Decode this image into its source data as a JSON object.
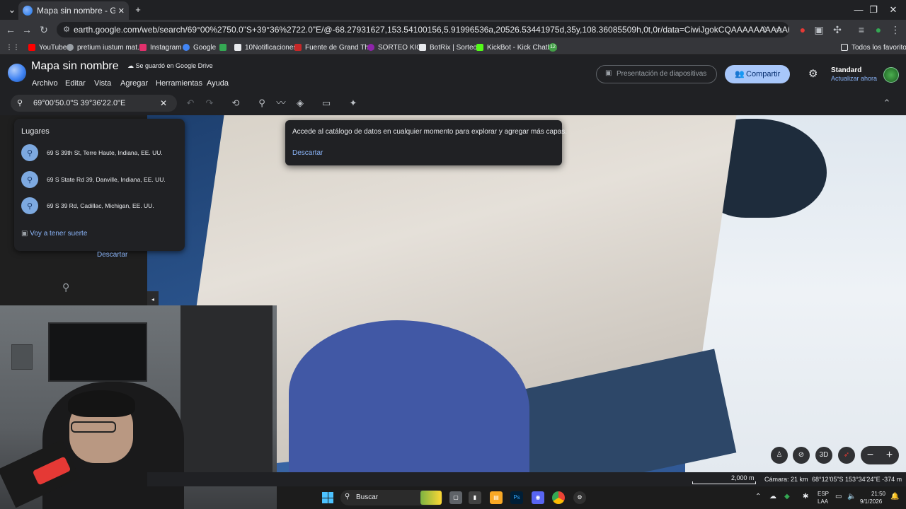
{
  "browser": {
    "tab_title": "Mapa sin nombre - Google Earth",
    "new_tab": "+",
    "url": "earth.google.com/web/search/69°00%2750.0\"S+39°36%2722.0\"E/@-68.27931627,153.54100156,5.91996536a,20526.53441975d,35y,108.36085509h,0t,0r/data=CiwiJgokCQAAAAAAAAAAEQAAAAAAAAAAGQAAAAAAAAAAIQAAAAAA..."
  },
  "bookmarks": [
    {
      "label": "YouTube",
      "color": "#ff0000"
    },
    {
      "label": "pretium iustum mat...",
      "color": "#9aa0a6"
    },
    {
      "label": "Instagram",
      "color": "#e1306c"
    },
    {
      "label": "Google",
      "color": "#4285f4"
    },
    {
      "label": "",
      "color": "#34a853"
    },
    {
      "label": "10Notificaciones",
      "color": "#e8eaed"
    },
    {
      "label": "Fuente de Grand Th...",
      "color": "#c62828"
    },
    {
      "label": "SORTEO KICK",
      "color": "#8e24aa"
    },
    {
      "label": "BotRix | Sorteos",
      "color": "#e8eaed"
    },
    {
      "label": "KickBot - Kick Chatb...",
      "color": "#53fc18"
    },
    {
      "label": "12",
      "color": "#43a047"
    }
  ],
  "bookmarks_all": "Todos los favoritos",
  "earth": {
    "doc_title": "Mapa sin nombre",
    "saved_status": "Se guardó en Google Drive",
    "menu": [
      "Archivo",
      "Editar",
      "Vista",
      "Agregar",
      "Herramientas",
      "Ayuda"
    ],
    "slideshow": "Presentación de diapositivas",
    "share": "Compartir",
    "plan": "Standard",
    "upgrade": "Actualizar ahora",
    "search_value": "69°00'50.0\"S 39°36'22.0\"E"
  },
  "places": {
    "heading": "Lugares",
    "items": [
      "69 S 39th St, Terre Haute, Indiana, EE. UU.",
      "69 S State Rd 39, Danville, Indiana, EE. UU.",
      "69 S 39 Rd, Cadillac, Michigan, EE. UU."
    ],
    "lucky": "Voy a tener suerte",
    "dismiss": "Descartar"
  },
  "tooltip": {
    "text": "Accede al catálogo de datos en cualquier momento para explorar y agregar más capas.",
    "dismiss": "Descartar"
  },
  "map_controls": {
    "three_d": "3D",
    "zoom_out": "−",
    "zoom_in": "+"
  },
  "status": {
    "scale": "2,000 m",
    "camera": "Cámara: 21 km",
    "coords": "68°12'05\"S 153°34'24\"E -374 m"
  },
  "taskbar": {
    "search": "Buscar",
    "lang1": "ESP",
    "lang2": "LAA",
    "time": "21:50",
    "date": "9/1/2026",
    "ps": "Ps"
  }
}
